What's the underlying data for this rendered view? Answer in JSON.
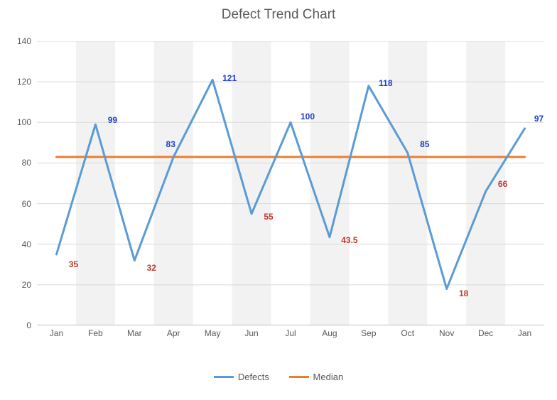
{
  "chart_data": {
    "type": "line",
    "title": "Defect Trend Chart",
    "xlabel": "",
    "ylabel": "",
    "ylim": [
      0,
      140
    ],
    "yticks": [
      0,
      20,
      40,
      60,
      80,
      100,
      120,
      140
    ],
    "categories": [
      "Jan",
      "Feb",
      "Mar",
      "Apr",
      "May",
      "Jun",
      "Jul",
      "Aug",
      "Sep",
      "Oct",
      "Nov",
      "Dec",
      "Jan"
    ],
    "series": [
      {
        "name": "Defects",
        "color": "#5B9BD5",
        "values": [
          35,
          99,
          32,
          83,
          121,
          55,
          100,
          43.5,
          118,
          85,
          18,
          66,
          97
        ]
      },
      {
        "name": "Median",
        "color": "#ED7D31",
        "values": [
          83,
          83,
          83,
          83,
          83,
          83,
          83,
          83,
          83,
          83,
          83,
          83,
          83
        ]
      }
    ],
    "data_labels": [
      {
        "i": 0,
        "text": "35",
        "cls": "low",
        "dx": 24,
        "dy": 14
      },
      {
        "i": 1,
        "text": "99",
        "cls": "high",
        "dx": 24,
        "dy": -6
      },
      {
        "i": 2,
        "text": "32",
        "cls": "low",
        "dx": 24,
        "dy": 10
      },
      {
        "i": 3,
        "text": "83",
        "cls": "high",
        "dx": -4,
        "dy": -18
      },
      {
        "i": 4,
        "text": "121",
        "cls": "high",
        "dx": 24,
        "dy": -2
      },
      {
        "i": 5,
        "text": "55",
        "cls": "low",
        "dx": 24,
        "dy": 4
      },
      {
        "i": 6,
        "text": "100",
        "cls": "high",
        "dx": 24,
        "dy": -8
      },
      {
        "i": 7,
        "text": "43.5",
        "cls": "low",
        "dx": 28,
        "dy": 4
      },
      {
        "i": 8,
        "text": "118",
        "cls": "high",
        "dx": 24,
        "dy": -4
      },
      {
        "i": 9,
        "text": "85",
        "cls": "high",
        "dx": 24,
        "dy": -12
      },
      {
        "i": 10,
        "text": "18",
        "cls": "low",
        "dx": 24,
        "dy": 6
      },
      {
        "i": 11,
        "text": "66",
        "cls": "low",
        "dx": 24,
        "dy": -10
      },
      {
        "i": 12,
        "text": "97",
        "cls": "high",
        "dx": 20,
        "dy": -14
      }
    ],
    "legend": {
      "defects": "Defects",
      "median": "Median"
    }
  }
}
